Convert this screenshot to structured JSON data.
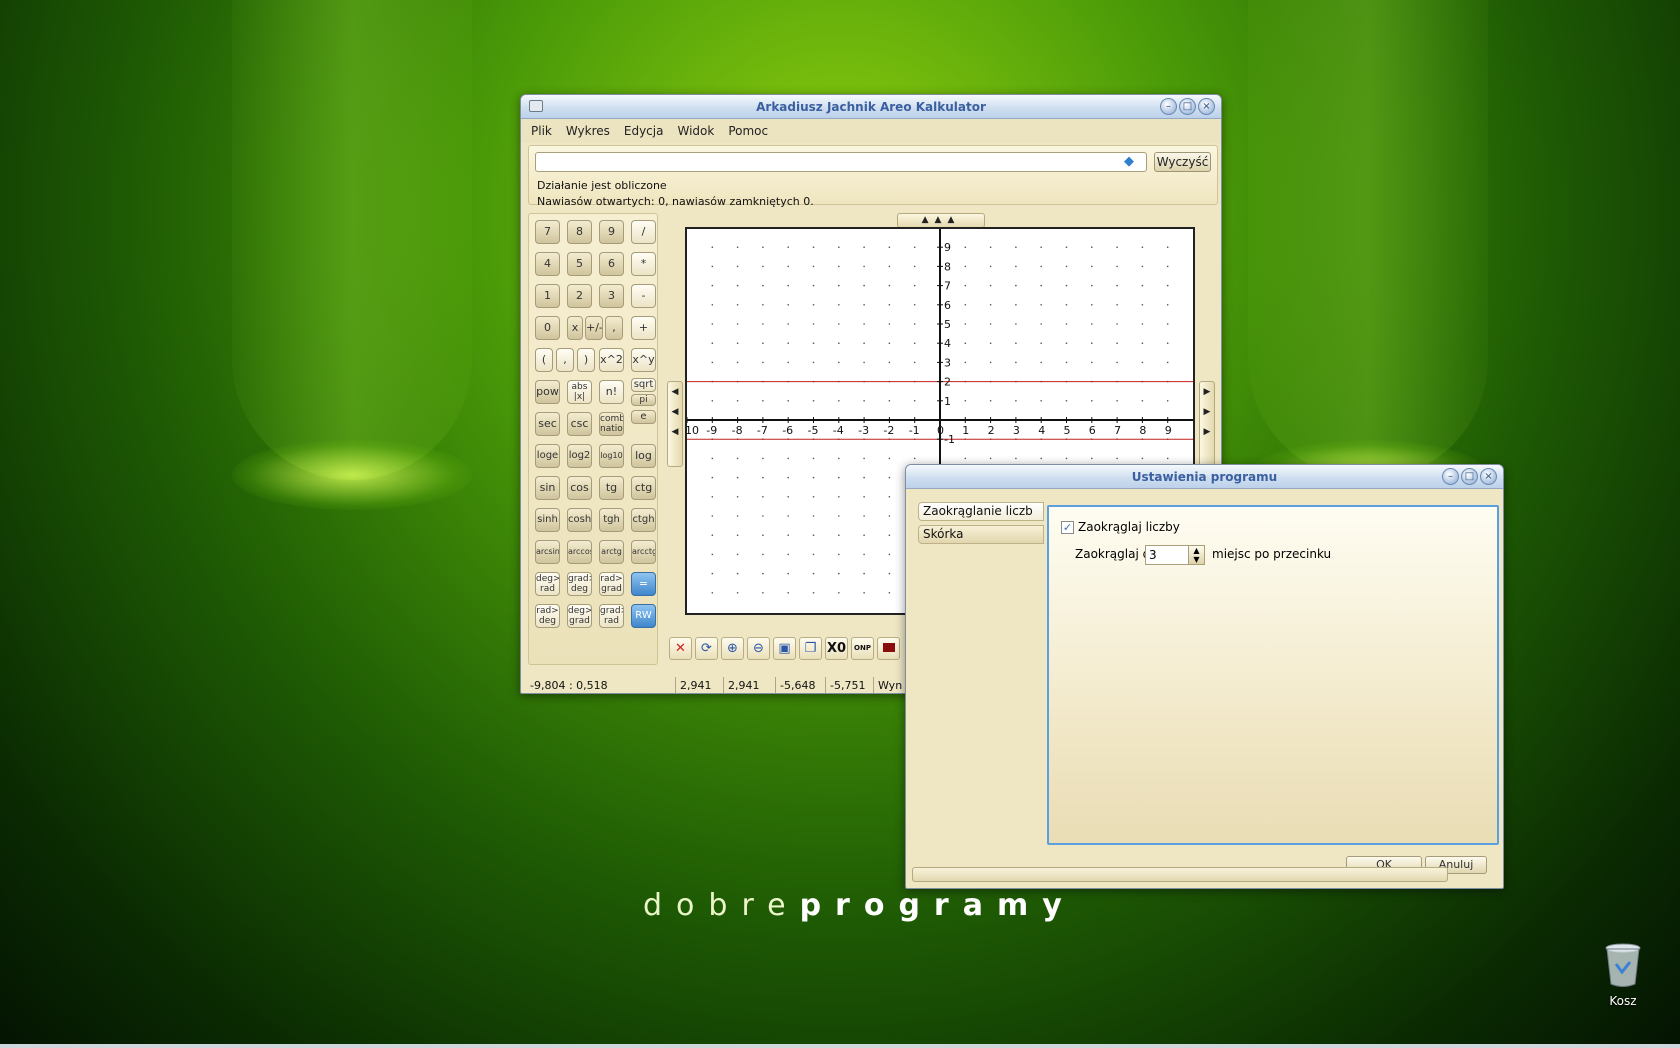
{
  "desktop": {
    "brand_light": "dobre",
    "brand_bold": "programy",
    "trash_label": "Kosz"
  },
  "main_window": {
    "title": "Arkadiusz Jachnik Areo Kalkulator",
    "menu": [
      "Plik",
      "Wykres",
      "Edycja",
      "Widok",
      "Pomoc"
    ],
    "expression_value": "",
    "clear_button": "Wyczyść",
    "status_line1": "Działanie jest obliczone",
    "status_line2": "Nawiasów otwartych: 0, nawiasów zamkniętych 0.",
    "keypad": [
      [
        "7",
        "8",
        "9",
        "/"
      ],
      [
        "4",
        "5",
        "6",
        "*"
      ],
      [
        "1",
        "2",
        "3",
        "-"
      ],
      [
        "0",
        "x",
        "+/-",
        ",",
        "+"
      ],
      [
        "(",
        ",",
        ")",
        "x^2",
        "x^y"
      ],
      [
        "pow",
        "abs |x|",
        "n!",
        "sqrt",
        "pi",
        "e"
      ],
      [
        "sec",
        "csc",
        "combi nation"
      ],
      [
        "loge",
        "log2",
        "log10",
        "log"
      ],
      [
        "sin",
        "cos",
        "tg",
        "ctg"
      ],
      [
        "sinh",
        "cosh",
        "tgh",
        "ctgh"
      ],
      [
        "arcsin",
        "arccos",
        "arctg",
        "arcctg"
      ],
      [
        "deg> rad",
        "grad> deg",
        "rad> grad",
        "="
      ],
      [
        "rad> deg",
        "deg> grad",
        "grad> rad",
        "RW"
      ]
    ],
    "graph": {
      "x_ticks": [
        "-10",
        "-9",
        "-8",
        "-7",
        "-6",
        "-5",
        "-4",
        "-3",
        "-2",
        "-1",
        "0",
        "1",
        "2",
        "3",
        "4",
        "5",
        "6",
        "7",
        "8",
        "9"
      ],
      "y_ticks": [
        "9",
        "8",
        "7",
        "6",
        "5",
        "4",
        "3",
        "2",
        "1",
        "0",
        "-1"
      ],
      "xlim": [
        -10,
        10
      ],
      "ylim": [
        -10,
        10
      ],
      "red_lines_y": [
        2,
        -1
      ]
    },
    "graph_toolbar": [
      "close-icon",
      "refresh-icon",
      "zoom-in-icon",
      "zoom-out-icon",
      "save-icon",
      "copy-icon",
      "X0",
      "ONP",
      "color-icon"
    ],
    "statusbar": [
      "-9,804 : 0,518",
      "2,941",
      "2,941",
      "-5,648",
      "-5,751",
      "Wyn"
    ]
  },
  "settings_window": {
    "title": "Ustawienia programu",
    "tabs": [
      "Zaokrąglanie liczb",
      "Skórka"
    ],
    "round_checkbox_label": "Zaokrąglaj liczby",
    "round_checked": true,
    "round_to_label": "Zaokrąglaj do",
    "round_value": "3",
    "round_suffix": "miejsc po przecinku",
    "ok_button": "OK",
    "apply_button": "Anuluj"
  },
  "colors": {
    "accent_blue": "#3f86cc",
    "panel_beige": "#efe7c4",
    "graph_red": "#c02020"
  }
}
